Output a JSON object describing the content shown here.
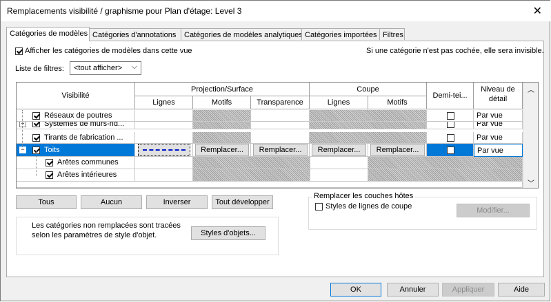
{
  "window": {
    "title": "Remplacements visibilité / graphisme pour Plan d'étage: Level 3",
    "close": "✕"
  },
  "tabs": [
    "Catégories de modèles",
    "Catégories d'annotations",
    "Catégories de modèles analytiques",
    "Catégories importées",
    "Filtres"
  ],
  "show_checkbox": {
    "label": "Afficher les catégories de modèles dans cette vue",
    "checked": true
  },
  "hint": "Si une catégorie n'est pas cochée, elle sera invisible.",
  "filter": {
    "label": "Liste de filtres:",
    "value": "<tout afficher>"
  },
  "grid": {
    "headers": {
      "visibility": "Visibilité",
      "projection": "Projection/Surface",
      "cut": "Coupe",
      "halftone": "Demi-tei...",
      "detail": "Niveau de détail"
    },
    "subheaders": {
      "lines": "Lignes",
      "patterns": "Motifs",
      "transparency": "Transparence",
      "cut_lines": "Lignes",
      "cut_patterns": "Motifs"
    },
    "rows": [
      {
        "name": "Réseaux de poutres",
        "detail": "Par vue"
      },
      {
        "name": "Systèmes de murs-rid...",
        "detail": "Par vue"
      },
      {
        "name": "Tirants de fabrication ...",
        "detail": "Par vue"
      },
      {
        "name": "Toits",
        "detail": "Par vue"
      },
      {
        "name": "Arêtes communes",
        "detail": ""
      },
      {
        "name": "Arêtes intérieures",
        "detail": ""
      }
    ],
    "override": "Remplacer..."
  },
  "buttons": {
    "all": "Tous",
    "none": "Aucun",
    "invert": "Inverser",
    "expand": "Tout développer"
  },
  "host": {
    "title": "Remplacer les couches hôtes",
    "checkbox": "Styles de lignes de coupe",
    "modify": "Modifier..."
  },
  "note": {
    "line1": "Les catégories non remplacées sont tracées",
    "line2": "selon les paramètres de style d'objet.",
    "button": "Styles d'objets..."
  },
  "footer": {
    "ok": "OK",
    "cancel": "Annuler",
    "apply": "Appliquer",
    "help": "Aide"
  }
}
